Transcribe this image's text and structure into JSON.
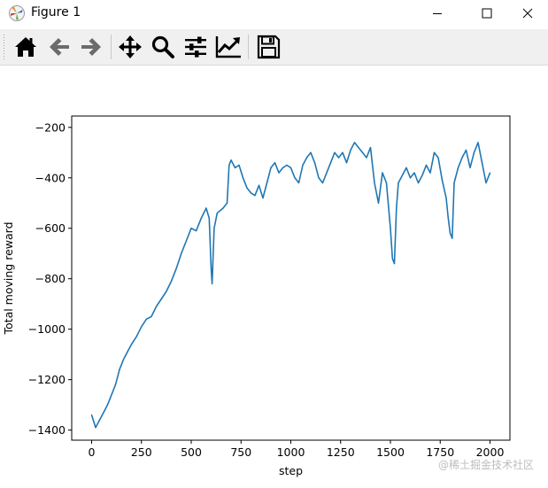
{
  "window": {
    "title": "Figure 1",
    "icon": "matplotlib-icon",
    "controls": [
      "minimize-icon",
      "maximize-icon",
      "close-icon"
    ]
  },
  "toolbar": {
    "buttons": [
      {
        "name": "home",
        "icon": "home-icon"
      },
      {
        "name": "back",
        "icon": "arrow-left-icon"
      },
      {
        "name": "forward",
        "icon": "arrow-right-icon"
      },
      {
        "name": "pan",
        "icon": "move-icon"
      },
      {
        "name": "zoom",
        "icon": "magnifier-icon"
      },
      {
        "name": "subplots",
        "icon": "sliders-icon"
      },
      {
        "name": "edit-axes",
        "icon": "line-chart-icon"
      },
      {
        "name": "save",
        "icon": "floppy-disk-icon"
      }
    ]
  },
  "chart_data": {
    "type": "line",
    "title": "",
    "xlabel": "step",
    "ylabel": "Total moving reward",
    "xlim": [
      -100,
      2100
    ],
    "ylim": [
      -1440,
      -155
    ],
    "xticks": [
      0,
      250,
      500,
      750,
      1000,
      1250,
      1500,
      1750,
      2000
    ],
    "yticks": [
      -1400,
      -1200,
      -1000,
      -800,
      -600,
      -400,
      -200
    ],
    "grid": false,
    "line_color": "#1f77b4",
    "series": [
      {
        "x": [
          0,
          20,
          40,
          60,
          80,
          100,
          120,
          140,
          160,
          180,
          200,
          225,
          250,
          275,
          300,
          325,
          350,
          375,
          400,
          425,
          450,
          475,
          500,
          525,
          550,
          575,
          590,
          600,
          605,
          615,
          630,
          660,
          680,
          690,
          700,
          720,
          740,
          760,
          780,
          800,
          820,
          840,
          860,
          880,
          900,
          920,
          940,
          960,
          980,
          1000,
          1020,
          1040,
          1060,
          1080,
          1100,
          1120,
          1140,
          1160,
          1180,
          1200,
          1220,
          1240,
          1260,
          1280,
          1300,
          1320,
          1340,
          1360,
          1380,
          1400,
          1420,
          1440,
          1460,
          1480,
          1500,
          1510,
          1520,
          1530,
          1540,
          1560,
          1580,
          1600,
          1620,
          1640,
          1660,
          1680,
          1700,
          1720,
          1740,
          1760,
          1780,
          1790,
          1800,
          1810,
          1820,
          1840,
          1860,
          1880,
          1900,
          1920,
          1940,
          1960,
          1980,
          2000
        ],
        "y": [
          -1340,
          -1390,
          -1360,
          -1330,
          -1300,
          -1260,
          -1220,
          -1160,
          -1120,
          -1090,
          -1060,
          -1030,
          -990,
          -960,
          -950,
          -910,
          -880,
          -850,
          -810,
          -760,
          -700,
          -650,
          -600,
          -610,
          -560,
          -520,
          -560,
          -760,
          -820,
          -600,
          -540,
          -520,
          -500,
          -350,
          -330,
          -360,
          -350,
          -400,
          -440,
          -460,
          -470,
          -430,
          -480,
          -420,
          -360,
          -340,
          -380,
          -360,
          -350,
          -360,
          -400,
          -420,
          -350,
          -320,
          -300,
          -340,
          -400,
          -420,
          -380,
          -340,
          -300,
          -320,
          -300,
          -340,
          -290,
          -260,
          -280,
          -300,
          -320,
          -280,
          -420,
          -500,
          -380,
          -420,
          -600,
          -720,
          -740,
          -520,
          -420,
          -390,
          -360,
          -400,
          -380,
          -420,
          -390,
          -350,
          -380,
          -300,
          -320,
          -410,
          -480,
          -560,
          -620,
          -640,
          -420,
          -360,
          -320,
          -290,
          -360,
          -300,
          -260,
          -340,
          -420,
          -380
        ]
      }
    ]
  },
  "watermark": "@稀土掘金技术社区"
}
